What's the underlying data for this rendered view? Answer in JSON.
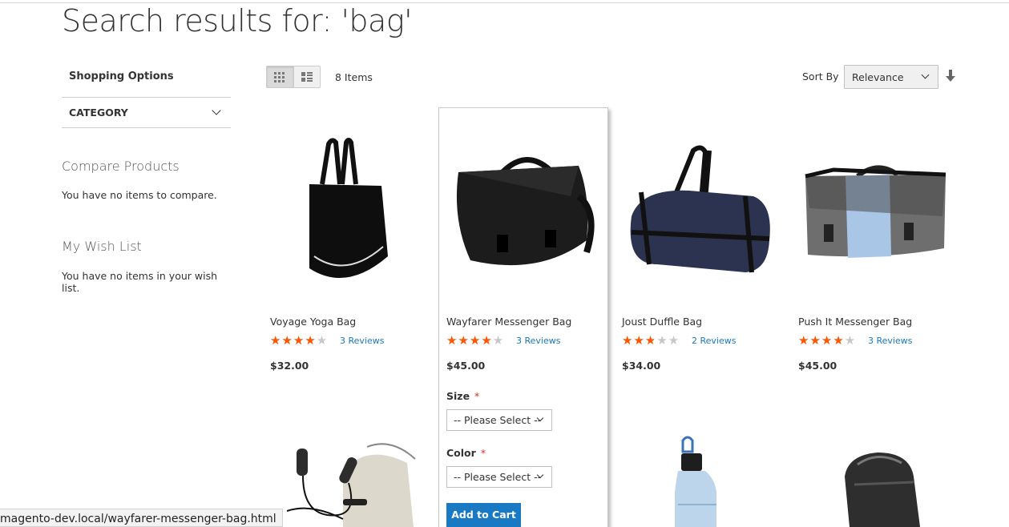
{
  "page": {
    "title": "Search results for: 'bag'"
  },
  "sidebar": {
    "shopping_options": "Shopping Options",
    "category": "CATEGORY",
    "compare_title": "Compare Products",
    "compare_text": "You have no items to compare.",
    "wishlist_title": "My Wish List",
    "wishlist_text": "You have no items in your wish list."
  },
  "toolbar": {
    "items_count": "8 Items",
    "sort_by_label": "Sort By",
    "sort_value": "Relevance",
    "view_mode_active": "grid"
  },
  "products": [
    {
      "name": "Voyage Yoga Bag",
      "rating": 3.5,
      "reviews": "3  Reviews",
      "price": "$32.00"
    },
    {
      "name": "Wayfarer Messenger Bag",
      "rating": 3.5,
      "reviews": "3  Reviews",
      "price": "$45.00"
    },
    {
      "name": "Joust Duffle Bag",
      "rating": 2.5,
      "reviews": "2  Reviews",
      "price": "$34.00"
    },
    {
      "name": "Push It Messenger Bag",
      "rating": 3.5,
      "reviews": "3  Reviews",
      "price": "$45.00"
    }
  ],
  "hover_options": {
    "size_label": "Size",
    "color_label": "Color",
    "required_mark": "*",
    "size_select": "-- Please Select --",
    "color_select": "-- Please Select --",
    "add_to_cart": "Add to Cart"
  },
  "status_bar": {
    "url": "magento-dev.local/wayfarer-messenger-bag.html"
  },
  "colors": {
    "accent": "#1979c3",
    "star": "#ff5501",
    "star_empty": "#c7c7c7",
    "required": "#e02b27"
  }
}
